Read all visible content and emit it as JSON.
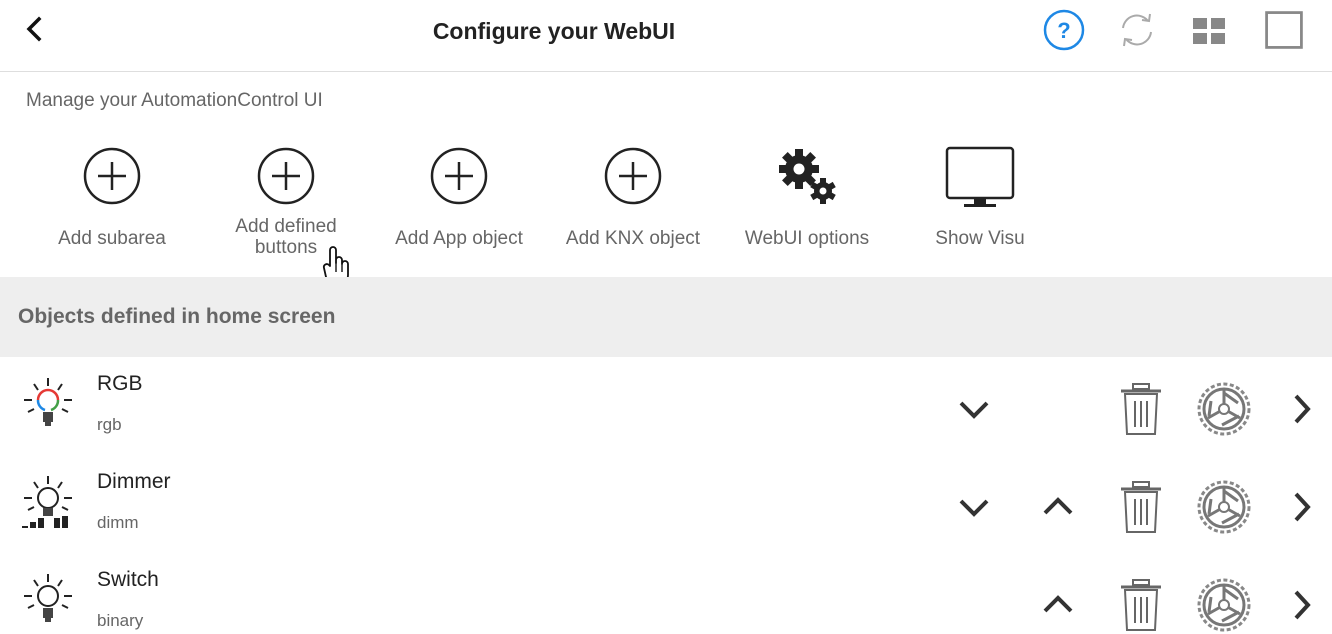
{
  "header": {
    "title": "Configure your WebUI",
    "help_glyph": "?",
    "icons": [
      "back-chevron-icon",
      "help-icon",
      "refresh-icon",
      "grid-icon",
      "fullscreen-icon"
    ],
    "accent_color": "#1e88e5"
  },
  "manage": {
    "label": "Manage your AutomationControl UI",
    "tools": [
      {
        "label": "Add subarea",
        "icon": "plus-circle-icon"
      },
      {
        "label": "Add defined buttons",
        "label_line1": "Add defined",
        "label_line2": "buttons",
        "icon": "plus-circle-icon"
      },
      {
        "label": "Add App object",
        "icon": "plus-circle-icon"
      },
      {
        "label": "Add KNX object",
        "icon": "plus-circle-icon"
      },
      {
        "label": "WebUI options",
        "icon": "gears-icon"
      },
      {
        "label": "Show Visu",
        "icon": "monitor-icon"
      }
    ]
  },
  "objects": {
    "section_title": "Objects defined in home screen",
    "rows": [
      {
        "name": "RGB",
        "type": "rgb",
        "icon": "rgb-bulb-icon",
        "actions": [
          "move-down",
          "delete",
          "settings",
          "open"
        ]
      },
      {
        "name": "Dimmer",
        "type": "dimm",
        "icon": "dimmer-bulb-icon",
        "actions": [
          "move-down",
          "move-up",
          "delete",
          "settings",
          "open"
        ]
      },
      {
        "name": "Switch",
        "type": "binary",
        "icon": "bulb-icon",
        "actions": [
          "move-up",
          "delete",
          "settings",
          "open"
        ]
      }
    ]
  }
}
